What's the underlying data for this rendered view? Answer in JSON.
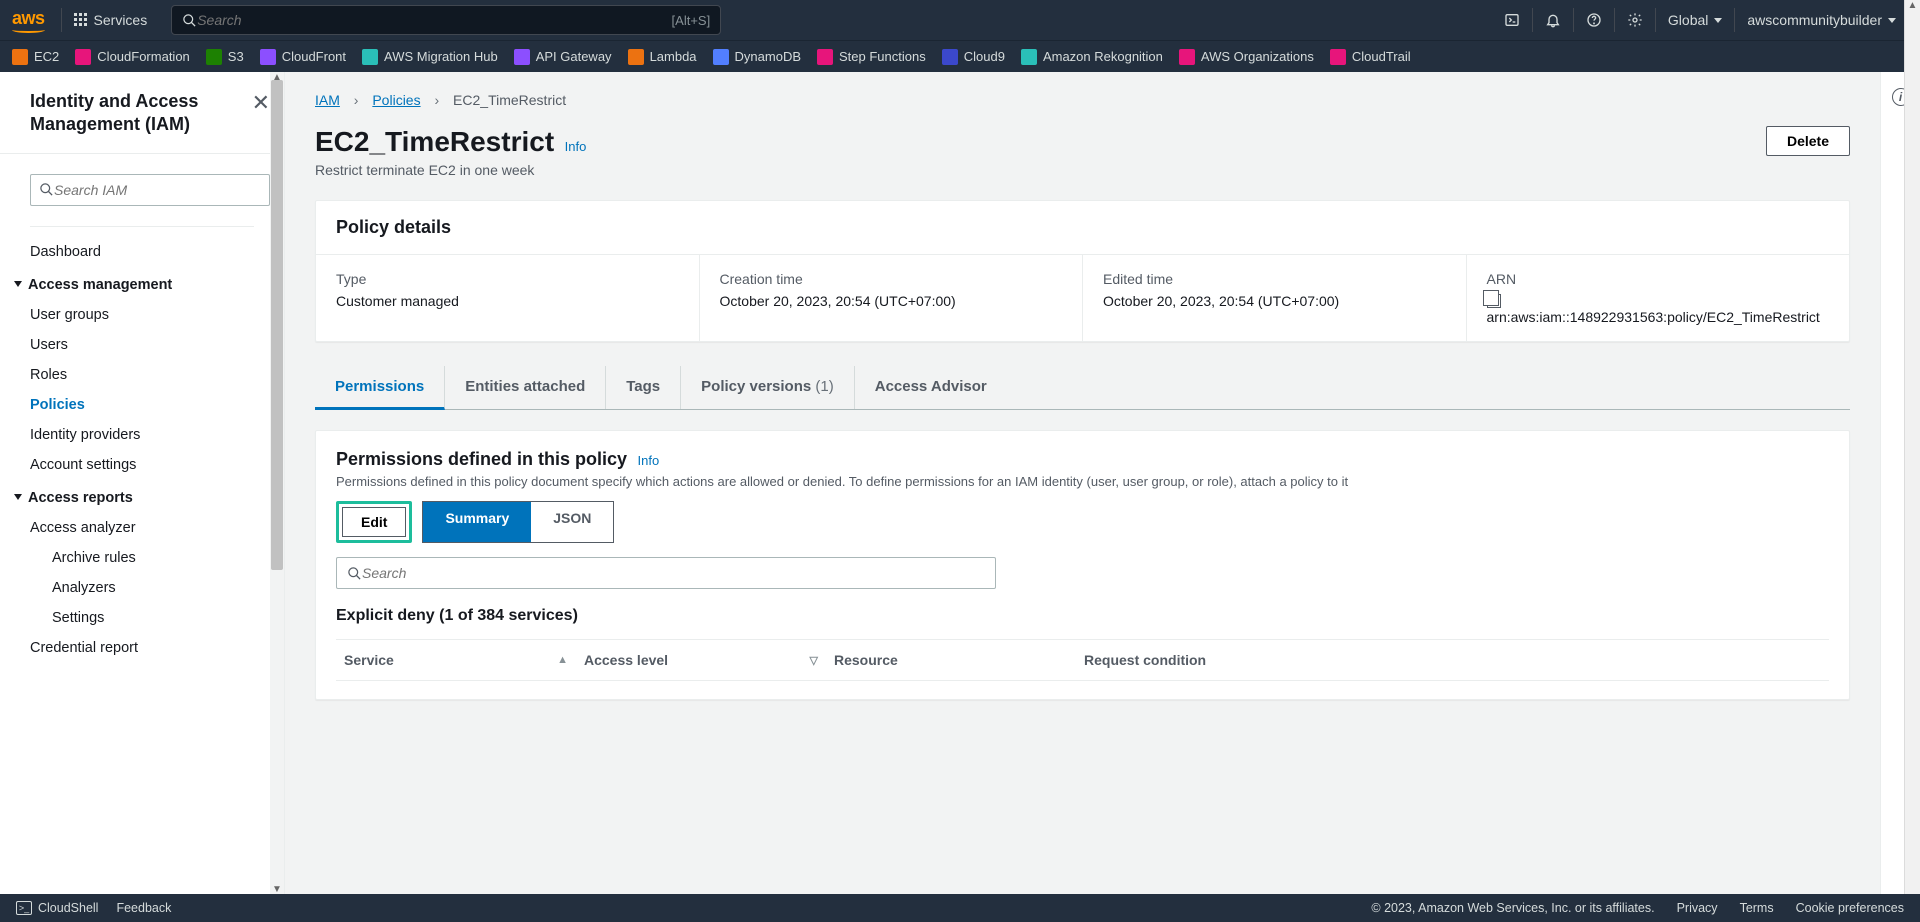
{
  "topnav": {
    "services": "Services",
    "search_placeholder": "Search",
    "search_shortcut": "[Alt+S]",
    "region": "Global",
    "account": "awscommunitybuilder"
  },
  "shortcuts": [
    {
      "label": "EC2",
      "color": "c-orange"
    },
    {
      "label": "CloudFormation",
      "color": "c-pink"
    },
    {
      "label": "S3",
      "color": "c-green"
    },
    {
      "label": "CloudFront",
      "color": "c-purple"
    },
    {
      "label": "AWS Migration Hub",
      "color": "c-teal"
    },
    {
      "label": "API Gateway",
      "color": "c-purple"
    },
    {
      "label": "Lambda",
      "color": "c-orange"
    },
    {
      "label": "DynamoDB",
      "color": "c-dblue"
    },
    {
      "label": "Step Functions",
      "color": "c-pink"
    },
    {
      "label": "Cloud9",
      "color": "c-blue"
    },
    {
      "label": "Amazon Rekognition",
      "color": "c-teal"
    },
    {
      "label": "AWS Organizations",
      "color": "c-pink"
    },
    {
      "label": "CloudTrail",
      "color": "c-pink"
    }
  ],
  "sidebar": {
    "title": "Identity and Access Management (IAM)",
    "search_placeholder": "Search IAM",
    "dashboard": "Dashboard",
    "sections": {
      "access_mgmt": {
        "label": "Access management",
        "items": [
          "User groups",
          "Users",
          "Roles",
          "Policies",
          "Identity providers",
          "Account settings"
        ]
      },
      "access_reports": {
        "label": "Access reports",
        "items": [
          "Access analyzer",
          "Archive rules",
          "Analyzers",
          "Settings",
          "Credential report"
        ]
      }
    }
  },
  "breadcrumb": {
    "root": "IAM",
    "mid": "Policies",
    "current": "EC2_TimeRestrict"
  },
  "page": {
    "title": "EC2_TimeRestrict",
    "info": "Info",
    "description": "Restrict terminate EC2 in one week",
    "delete": "Delete"
  },
  "policy_details": {
    "panel_title": "Policy details",
    "type_label": "Type",
    "type_value": "Customer managed",
    "created_label": "Creation time",
    "created_value": "October 20, 2023, 20:54 (UTC+07:00)",
    "edited_label": "Edited time",
    "edited_value": "October 20, 2023, 20:54 (UTC+07:00)",
    "arn_label": "ARN",
    "arn_value": "arn:aws:iam::148922931563:policy/EC2_TimeRestrict"
  },
  "tabs": {
    "permissions": "Permissions",
    "entities": "Entities attached",
    "tags": "Tags",
    "versions": "Policy versions ",
    "versions_count": "(1)",
    "advisor": "Access Advisor"
  },
  "permissions": {
    "heading": "Permissions defined in this policy",
    "info": "Info",
    "desc": "Permissions defined in this policy document specify which actions are allowed or denied. To define permissions for an IAM identity (user, user group, or role), attach a policy to it",
    "edit": "Edit",
    "summary": "Summary",
    "json": "JSON",
    "filter_placeholder": "Search",
    "deny_header": "Explicit deny (1 of 384 services)",
    "columns": {
      "service": "Service",
      "access": "Access level",
      "resource": "Resource",
      "condition": "Request condition"
    }
  },
  "footer": {
    "cloudshell": "CloudShell",
    "feedback": "Feedback",
    "copyright": "© 2023, Amazon Web Services, Inc. or its affiliates.",
    "privacy": "Privacy",
    "terms": "Terms",
    "cookies": "Cookie preferences"
  }
}
